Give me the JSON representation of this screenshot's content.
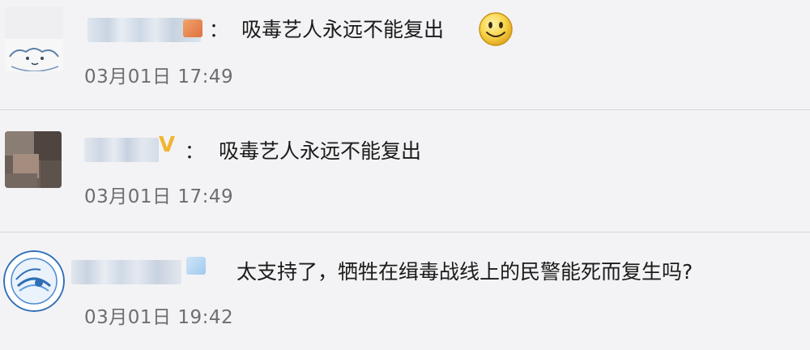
{
  "comments": [
    {
      "separator": "：",
      "text": "吸毒艺人永远不能复出",
      "emoji": "smiley-emoji",
      "time": "03月01日 17:49"
    },
    {
      "separator": "：",
      "verified_badge": "V",
      "text": "吸毒艺人永远不能复出",
      "time": "03月01日 17:49"
    },
    {
      "text": "太支持了，牺牲在缉毒战线上的民警能死而复生吗?",
      "time": "03月01日 19:42"
    }
  ],
  "colors": {
    "background": "#f3f3f5",
    "divider": "#d8d8dc",
    "text": "#1b1b1b",
    "time": "#6d6d72",
    "verified": "#f2b431"
  }
}
